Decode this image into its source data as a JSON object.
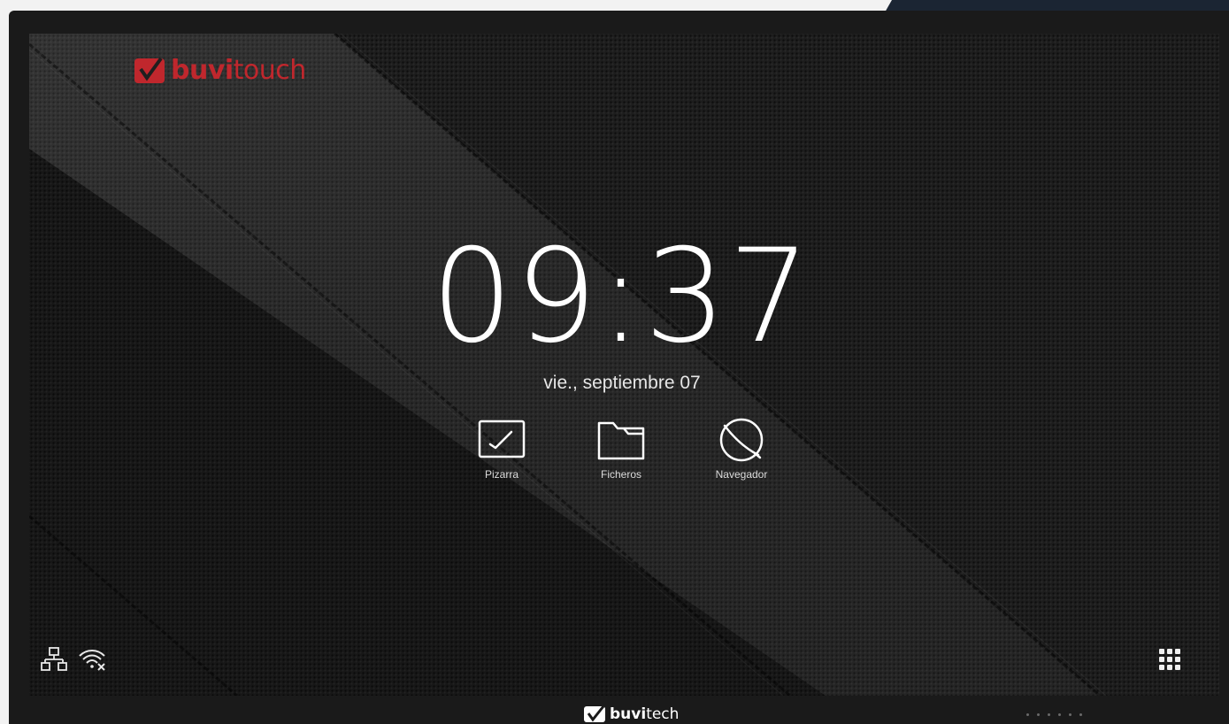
{
  "brand": {
    "logo_prefix": "buvi",
    "logo_suffix": "touch",
    "bezel_prefix": "buvi",
    "bezel_suffix": "tech",
    "logo_color": "#c0272d"
  },
  "clock": {
    "time": "09:37",
    "date": "vie., septiembre 07"
  },
  "apps": [
    {
      "label": "Pizarra",
      "icon": "whiteboard-icon"
    },
    {
      "label": "Ficheros",
      "icon": "folder-icon"
    },
    {
      "label": "Navegador",
      "icon": "browser-globe-icon"
    }
  ],
  "status": {
    "ethernet_icon": "ethernet-network-icon",
    "wifi_icon": "wifi-disconnected-icon",
    "apps_icon": "app-grid-icon"
  }
}
